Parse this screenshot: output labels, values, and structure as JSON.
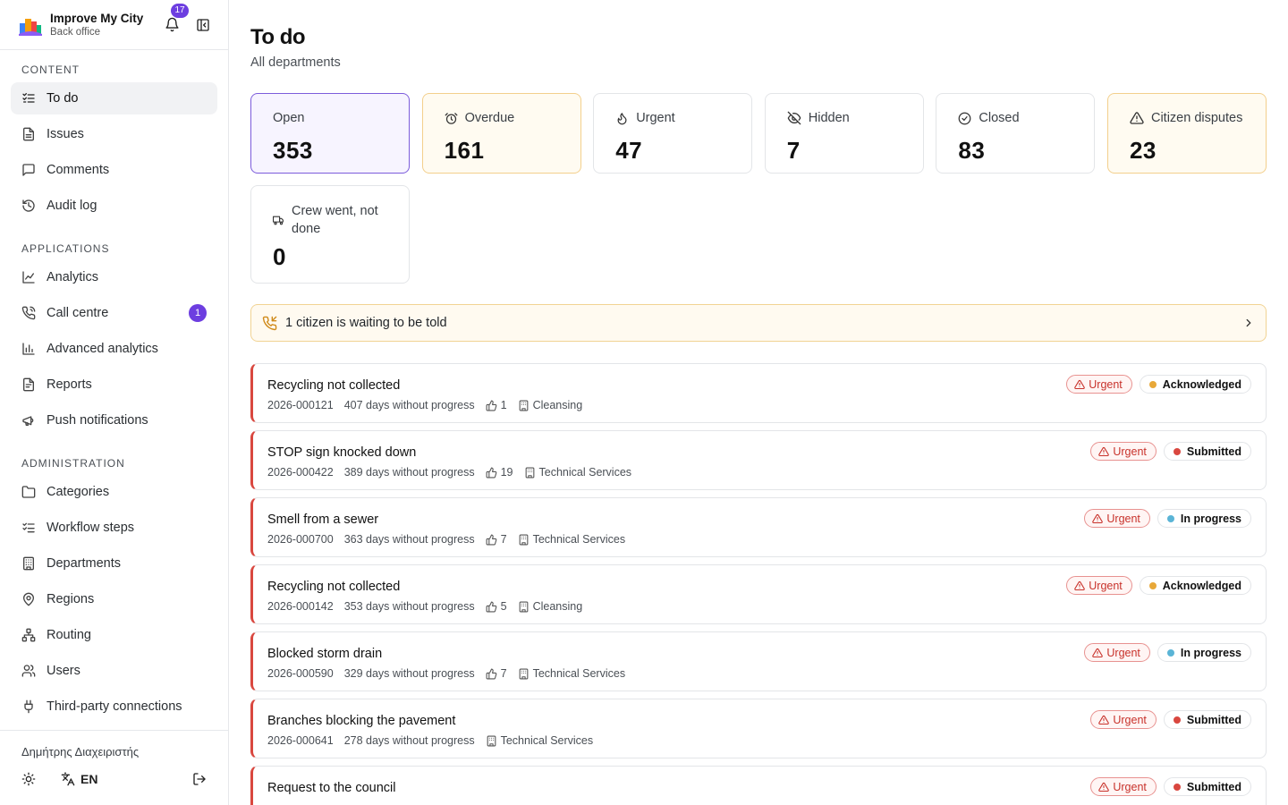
{
  "brand": {
    "title": "Improve My City",
    "subtitle": "Back office",
    "notification_count": "17"
  },
  "sections": {
    "content": "CONTENT",
    "applications": "APPLICATIONS",
    "administration": "ADMINISTRATION"
  },
  "nav": {
    "content": [
      {
        "label": "To do",
        "icon": "checklist-icon"
      },
      {
        "label": "Issues",
        "icon": "document-icon"
      },
      {
        "label": "Comments",
        "icon": "comment-icon"
      },
      {
        "label": "Audit log",
        "icon": "history-icon"
      }
    ],
    "applications": [
      {
        "label": "Analytics",
        "icon": "line-chart-icon"
      },
      {
        "label": "Call centre",
        "icon": "phone-icon",
        "badge": "1"
      },
      {
        "label": "Advanced analytics",
        "icon": "bar-chart-icon"
      },
      {
        "label": "Reports",
        "icon": "report-icon"
      },
      {
        "label": "Push notifications",
        "icon": "megaphone-icon"
      }
    ],
    "administration": [
      {
        "label": "Categories",
        "icon": "folder-icon"
      },
      {
        "label": "Workflow steps",
        "icon": "list-check-icon"
      },
      {
        "label": "Departments",
        "icon": "building-icon"
      },
      {
        "label": "Regions",
        "icon": "map-pin-icon"
      },
      {
        "label": "Routing",
        "icon": "network-icon"
      },
      {
        "label": "Users",
        "icon": "users-icon"
      },
      {
        "label": "Third-party connections",
        "icon": "plug-icon"
      }
    ]
  },
  "footer": {
    "user": "Δημήτρης Διαχειριστής",
    "language": "EN"
  },
  "page": {
    "title": "To do",
    "subtitle": "All departments"
  },
  "cards": [
    {
      "label": "Open",
      "value": "353",
      "icon": "none"
    },
    {
      "label": "Overdue",
      "value": "161",
      "icon": "alarm-clock-icon"
    },
    {
      "label": "Urgent",
      "value": "47",
      "icon": "flame-icon"
    },
    {
      "label": "Hidden",
      "value": "7",
      "icon": "eye-off-icon"
    },
    {
      "label": "Closed",
      "value": "83",
      "icon": "check-circle-icon"
    },
    {
      "label": "Citizen disputes",
      "value": "23",
      "icon": "warning-triangle-icon"
    },
    {
      "label": "Crew went, not done",
      "value": "0",
      "icon": "truck-icon"
    }
  ],
  "callout": {
    "text": "1 citizen is waiting to be told"
  },
  "issues": [
    {
      "title": "Recycling not collected",
      "id": "2026-000121",
      "age": "407 days without progress",
      "votes": "1",
      "department": "Cleansing",
      "priority": "Urgent",
      "status": "Acknowledged",
      "status_color": "#e8a838"
    },
    {
      "title": "STOP sign knocked down",
      "id": "2026-000422",
      "age": "389 days without progress",
      "votes": "19",
      "department": "Technical Services",
      "priority": "Urgent",
      "status": "Submitted",
      "status_color": "#d9473f"
    },
    {
      "title": "Smell from a sewer",
      "id": "2026-000700",
      "age": "363 days without progress",
      "votes": "7",
      "department": "Technical Services",
      "priority": "Urgent",
      "status": "In progress",
      "status_color": "#5ab4d6"
    },
    {
      "title": "Recycling not collected",
      "id": "2026-000142",
      "age": "353 days without progress",
      "votes": "5",
      "department": "Cleansing",
      "priority": "Urgent",
      "status": "Acknowledged",
      "status_color": "#e8a838"
    },
    {
      "title": "Blocked storm drain",
      "id": "2026-000590",
      "age": "329 days without progress",
      "votes": "7",
      "department": "Technical Services",
      "priority": "Urgent",
      "status": "In progress",
      "status_color": "#5ab4d6"
    },
    {
      "title": "Branches blocking the pavement",
      "id": "2026-000641",
      "age": "278 days without progress",
      "votes": "",
      "department": "Technical Services",
      "priority": "Urgent",
      "status": "Submitted",
      "status_color": "#d9473f"
    },
    {
      "title": "Request to the council",
      "id": "",
      "age": "",
      "votes": "",
      "department": "",
      "priority": "Urgent",
      "status": "Submitted",
      "status_color": "#d9473f"
    }
  ],
  "colors": {
    "accent": "#6d3ee0",
    "urgent": "#d9473f",
    "warning_bg": "#fffbf1"
  }
}
